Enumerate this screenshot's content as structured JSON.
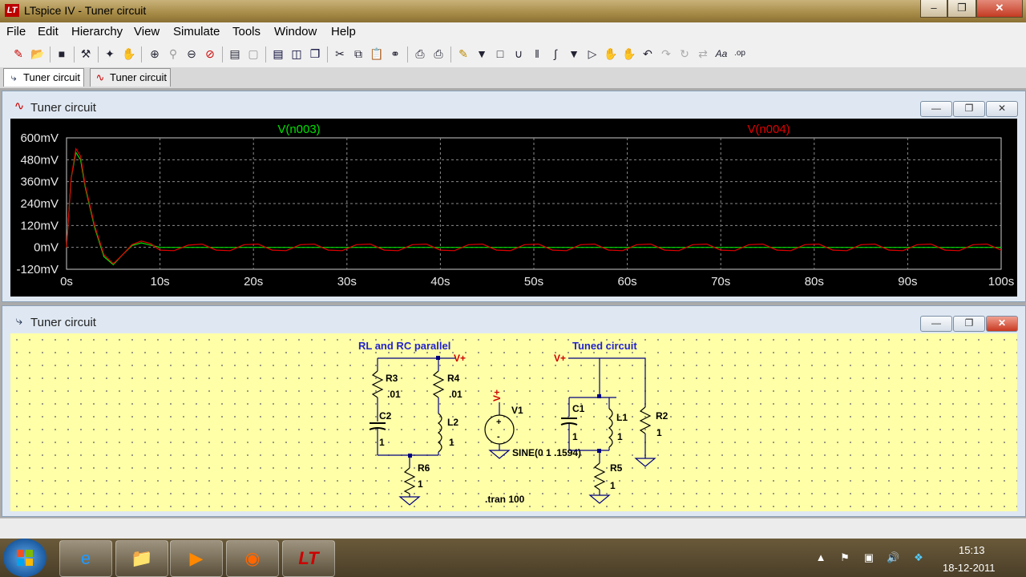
{
  "window": {
    "title": "LTspice IV - Tuner circuit",
    "logo_text": "LT"
  },
  "menu": [
    "File",
    "Edit",
    "Hierarchy",
    "View",
    "Simulate",
    "Tools",
    "Window",
    "Help"
  ],
  "tabs": [
    {
      "label": "Tuner circuit"
    },
    {
      "label": "Tuner circuit"
    }
  ],
  "plot_window": {
    "title": "Tuner circuit"
  },
  "schematic_window": {
    "title": "Tuner circuit"
  },
  "colors": {
    "trace_green": "#00e000",
    "trace_red": "#e00000",
    "grid": "#8a8a8a",
    "schematic_bg": "#ffffa8",
    "wire": "#000080"
  },
  "chart_data": {
    "type": "line",
    "series": [
      {
        "name": "V(n003)",
        "color": "green",
        "x": [
          0,
          0.5,
          1,
          1.5,
          2,
          3,
          4,
          5,
          6,
          7,
          8,
          9,
          10,
          12,
          14,
          16,
          18,
          20,
          25,
          30,
          35,
          40,
          45,
          50,
          55,
          60,
          65,
          70,
          75,
          80,
          85,
          90,
          95,
          100
        ],
        "y": [
          0,
          380,
          520,
          480,
          330,
          110,
          -50,
          -95,
          -40,
          10,
          25,
          12,
          0,
          0,
          0,
          0,
          0,
          0,
          0,
          0,
          0,
          0,
          0,
          0,
          0,
          0,
          0,
          0,
          0,
          0,
          0,
          0,
          0,
          0
        ]
      },
      {
        "name": "V(n004)",
        "color": "red",
        "x": [
          0,
          0.5,
          1,
          1.5,
          2,
          3,
          4,
          5,
          6,
          7,
          8,
          9,
          10,
          11.5,
          13,
          14.5,
          16,
          17.5,
          19,
          20.5,
          22,
          23.5,
          25,
          26.5,
          28,
          29.5,
          31,
          32.5,
          34,
          35.5,
          37,
          38.5,
          40,
          41.5,
          43,
          44.5,
          46,
          47.5,
          49,
          50.5,
          52,
          53.5,
          55,
          56.5,
          58,
          59.5,
          61,
          62.5,
          64,
          65.5,
          67,
          68.5,
          70,
          71.5,
          73,
          74.5,
          76,
          77.5,
          79,
          80.5,
          82,
          83.5,
          85,
          86.5,
          88,
          89.5,
          91,
          92.5,
          94,
          95.5,
          97,
          98.5,
          100
        ],
        "y": [
          0,
          380,
          540,
          500,
          340,
          120,
          -40,
          -90,
          -40,
          15,
          35,
          20,
          -15,
          -18,
          12,
          18,
          -15,
          -18,
          15,
          18,
          -15,
          -18,
          15,
          18,
          -15,
          -18,
          15,
          18,
          -15,
          -18,
          15,
          18,
          -15,
          -18,
          15,
          18,
          -15,
          -18,
          15,
          18,
          -15,
          -18,
          15,
          18,
          -15,
          -18,
          15,
          18,
          -15,
          -18,
          15,
          18,
          -15,
          -18,
          15,
          18,
          -15,
          -18,
          15,
          18,
          -15,
          -18,
          15,
          18,
          -15,
          -18,
          15,
          18,
          -15,
          -18,
          15,
          18,
          -15
        ]
      }
    ],
    "xticks": [
      "0s",
      "10s",
      "20s",
      "30s",
      "40s",
      "50s",
      "60s",
      "70s",
      "80s",
      "90s",
      "100s"
    ],
    "yticks": [
      "600mV",
      "480mV",
      "360mV",
      "240mV",
      "120mV",
      "0mV",
      "-120mV"
    ],
    "xlim": [
      0,
      100
    ],
    "ylim": [
      -120,
      600
    ],
    "grid": true,
    "xlabel": "",
    "ylabel": ""
  },
  "schematic": {
    "labels": {
      "rl_rc_title": "RL and RC parallel",
      "tuned_title": "Tuned circuit",
      "vplus1": "V+",
      "vplus2": "V+",
      "vplus_src": "V+",
      "r3": "R3",
      "r3v": ".01",
      "c2": "C2",
      "c2v": "1",
      "r4": "R4",
      "r4v": ".01",
      "l2": "L2",
      "l2v": "1",
      "r6": "R6",
      "r6v": "1",
      "v1": "V1",
      "v1v": "SINE(0 1 .1594)",
      "c1": "C1",
      "c1v": "1",
      "l1": "L1",
      "l1v": "1",
      "r2": "R2",
      "r2v": "1",
      "r5": "R5",
      "r5v": "1",
      "tran": ".tran 100"
    }
  },
  "taskbar": {
    "time": "15:13",
    "date": "18-12-2011"
  }
}
